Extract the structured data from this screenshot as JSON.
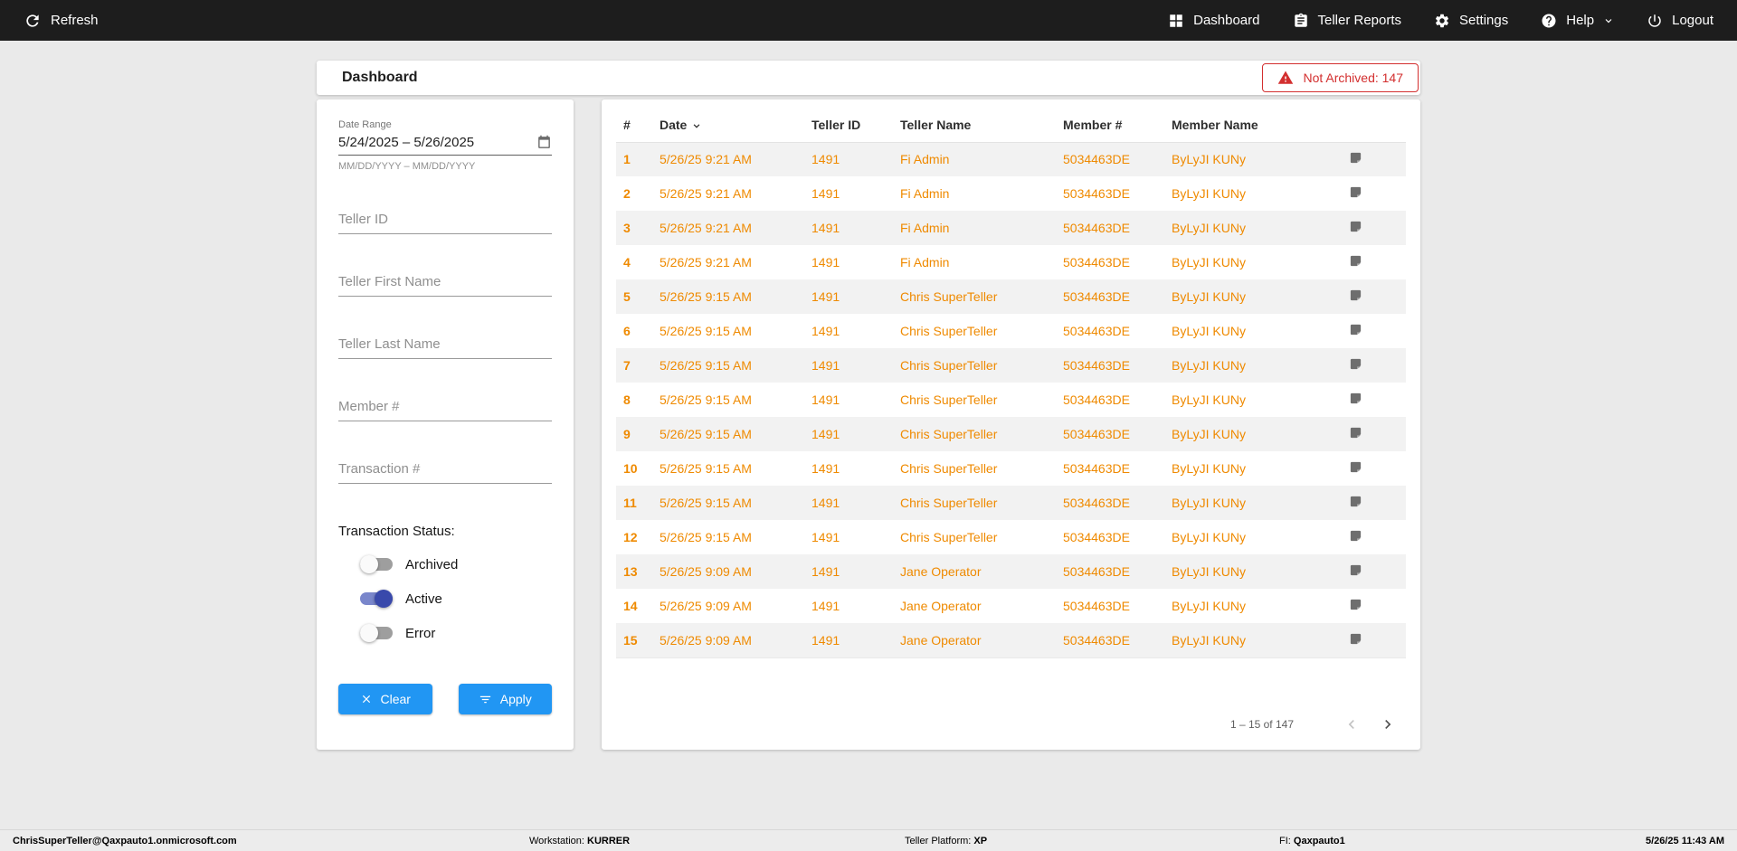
{
  "topbar": {
    "refresh_label": "Refresh",
    "nav": [
      {
        "label": "Dashboard"
      },
      {
        "label": "Teller Reports"
      },
      {
        "label": "Settings"
      },
      {
        "label": "Help"
      },
      {
        "label": "Logout"
      }
    ]
  },
  "header": {
    "title": "Dashboard",
    "badge_label": "Not Archived: 147"
  },
  "filters": {
    "date_range_label": "Date Range",
    "date_range_value": "5/24/2025 – 5/26/2025",
    "date_range_hint": "MM/DD/YYYY – MM/DD/YYYY",
    "fields": [
      {
        "placeholder": "Teller ID"
      },
      {
        "placeholder": "Teller First Name"
      },
      {
        "placeholder": "Teller Last Name"
      },
      {
        "placeholder": "Member #"
      },
      {
        "placeholder": "Transaction #"
      }
    ],
    "status_label": "Transaction Status:",
    "toggles": [
      {
        "label": "Archived",
        "on": false
      },
      {
        "label": "Active",
        "on": true
      },
      {
        "label": "Error",
        "on": false
      }
    ],
    "clear_label": "Clear",
    "apply_label": "Apply"
  },
  "table": {
    "columns": [
      "#",
      "Date",
      "Teller ID",
      "Teller Name",
      "Member #",
      "Member Name"
    ],
    "rows": [
      {
        "num": "1",
        "date": "5/26/25 9:21 AM",
        "teller_id": "1491",
        "teller_name": "Fi Admin",
        "member_number": "5034463DE",
        "member_name": "ByLyJI KUNy"
      },
      {
        "num": "2",
        "date": "5/26/25 9:21 AM",
        "teller_id": "1491",
        "teller_name": "Fi Admin",
        "member_number": "5034463DE",
        "member_name": "ByLyJI KUNy"
      },
      {
        "num": "3",
        "date": "5/26/25 9:21 AM",
        "teller_id": "1491",
        "teller_name": "Fi Admin",
        "member_number": "5034463DE",
        "member_name": "ByLyJI KUNy"
      },
      {
        "num": "4",
        "date": "5/26/25 9:21 AM",
        "teller_id": "1491",
        "teller_name": "Fi Admin",
        "member_number": "5034463DE",
        "member_name": "ByLyJI KUNy"
      },
      {
        "num": "5",
        "date": "5/26/25 9:15 AM",
        "teller_id": "1491",
        "teller_name": "Chris SuperTeller",
        "member_number": "5034463DE",
        "member_name": "ByLyJI KUNy"
      },
      {
        "num": "6",
        "date": "5/26/25 9:15 AM",
        "teller_id": "1491",
        "teller_name": "Chris SuperTeller",
        "member_number": "5034463DE",
        "member_name": "ByLyJI KUNy"
      },
      {
        "num": "7",
        "date": "5/26/25 9:15 AM",
        "teller_id": "1491",
        "teller_name": "Chris SuperTeller",
        "member_number": "5034463DE",
        "member_name": "ByLyJI KUNy"
      },
      {
        "num": "8",
        "date": "5/26/25 9:15 AM",
        "teller_id": "1491",
        "teller_name": "Chris SuperTeller",
        "member_number": "5034463DE",
        "member_name": "ByLyJI KUNy"
      },
      {
        "num": "9",
        "date": "5/26/25 9:15 AM",
        "teller_id": "1491",
        "teller_name": "Chris SuperTeller",
        "member_number": "5034463DE",
        "member_name": "ByLyJI KUNy"
      },
      {
        "num": "10",
        "date": "5/26/25 9:15 AM",
        "teller_id": "1491",
        "teller_name": "Chris SuperTeller",
        "member_number": "5034463DE",
        "member_name": "ByLyJI KUNy"
      },
      {
        "num": "11",
        "date": "5/26/25 9:15 AM",
        "teller_id": "1491",
        "teller_name": "Chris SuperTeller",
        "member_number": "5034463DE",
        "member_name": "ByLyJI KUNy"
      },
      {
        "num": "12",
        "date": "5/26/25 9:15 AM",
        "teller_id": "1491",
        "teller_name": "Chris SuperTeller",
        "member_number": "5034463DE",
        "member_name": "ByLyJI KUNy"
      },
      {
        "num": "13",
        "date": "5/26/25 9:09 AM",
        "teller_id": "1491",
        "teller_name": "Jane Operator",
        "member_number": "5034463DE",
        "member_name": "ByLyJI KUNy"
      },
      {
        "num": "14",
        "date": "5/26/25 9:09 AM",
        "teller_id": "1491",
        "teller_name": "Jane Operator",
        "member_number": "5034463DE",
        "member_name": "ByLyJI KUNy"
      },
      {
        "num": "15",
        "date": "5/26/25 9:09 AM",
        "teller_id": "1491",
        "teller_name": "Jane Operator",
        "member_number": "5034463DE",
        "member_name": "ByLyJI KUNy"
      }
    ],
    "pagination_label": "1 – 15 of 147"
  },
  "statusbar": {
    "user": "ChrisSuperTeller@Qaxpauto1.onmicrosoft.com",
    "workstation_label": "Workstation:",
    "workstation_value": "KURRER",
    "platform_label": "Teller Platform:",
    "platform_value": "XP",
    "fi_label": "FI:",
    "fi_value": "Qaxpauto1",
    "datetime": "5/26/25 11:43 AM"
  },
  "colors": {
    "topbar_bg": "#1d1d1d",
    "accent_orange": "#ef8a00",
    "accent_blue": "#2196f3",
    "alert_red": "#d32f2f",
    "toggle_on_thumb": "#3949ab",
    "toggle_on_track": "#7986cb",
    "row_stripe": "#f2f2f2"
  }
}
